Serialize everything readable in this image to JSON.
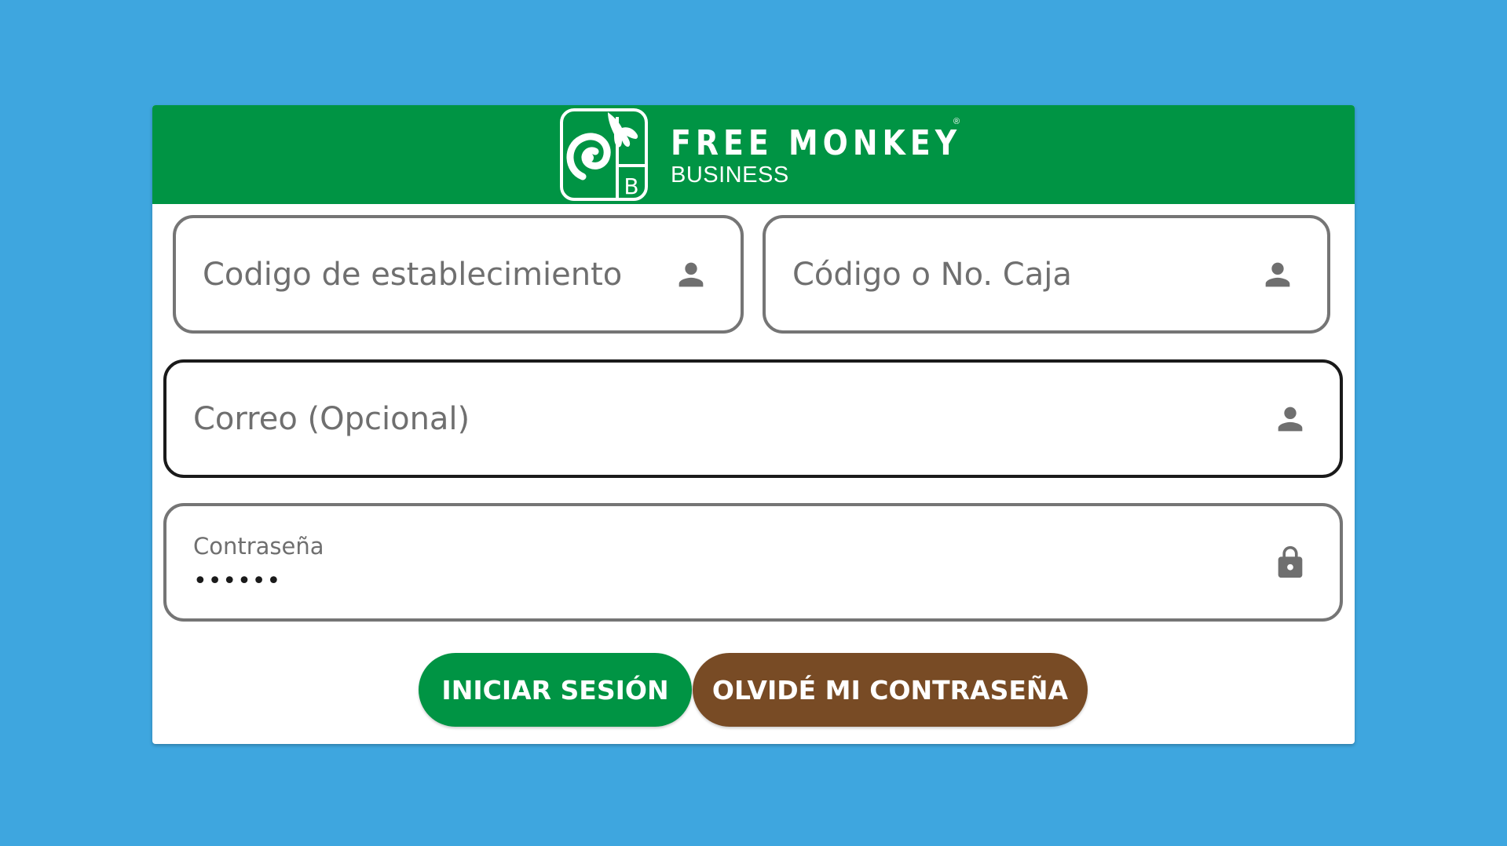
{
  "colors": {
    "background": "#3ea6df",
    "header": "#009444",
    "login_button": "#009444",
    "forgot_button": "#784b25",
    "field_border": "#757575",
    "field_border_focused": "#1a1a1a"
  },
  "brand": {
    "title": "FREE MONKEY",
    "registered_mark": "®",
    "subtitle": "BUSINESS",
    "badge_letter": "B"
  },
  "form": {
    "establishment_code": {
      "placeholder": "Codigo de establecimiento",
      "value": "",
      "icon": "person-icon"
    },
    "register_code": {
      "placeholder": "Código o No. Caja",
      "value": "",
      "icon": "person-icon"
    },
    "email": {
      "placeholder": "Correo (Opcional)",
      "value": "",
      "icon": "person-icon"
    },
    "password": {
      "label": "Contraseña",
      "masked_value": "••••••",
      "icon": "lock-icon"
    }
  },
  "buttons": {
    "login": "INICIAR SESIÓN",
    "forgot_password": "OLVIDÉ MI CONTRASEÑA"
  }
}
